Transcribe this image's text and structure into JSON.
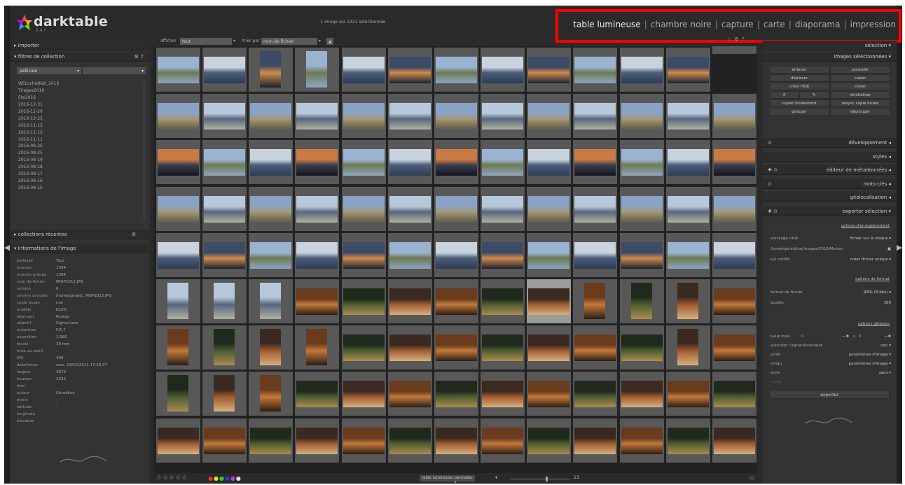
{
  "app": {
    "name": "darktable",
    "version": "2.4.?"
  },
  "header": {
    "selection_count": "1 image sur 1321 sélectionnée"
  },
  "views": [
    {
      "label": "table lumineuse",
      "active": true
    },
    {
      "label": "chambre noire",
      "active": false
    },
    {
      "label": "capture",
      "active": false
    },
    {
      "label": "carte",
      "active": false
    },
    {
      "label": "diaporama",
      "active": false
    },
    {
      "label": "impression",
      "active": false
    }
  ],
  "views_sep": "|",
  "toolbar": {
    "show_label": "afficher",
    "show_value": "tout",
    "sort_label": "trier par",
    "sort_value": "nom de fichier"
  },
  "left": {
    "import_label": "importer",
    "collect_label": "filtres de collection",
    "collect_icons": "⚙ ↑",
    "collect_property": "pellicule",
    "film_rolls": [
      "WELoche8&B_2016",
      "Tirages2016",
      "Ete2016",
      "2016-12-31",
      "2016-12-26",
      "2016-12-25",
      "2016-11-13",
      "2016-11-12",
      "2016-11-11",
      "2016-08-26",
      "2016-08-25",
      "2016-08-19",
      "2016-08-18",
      "2016-08-17",
      "2016-08-16",
      "2016-08-15"
    ],
    "recent_label": "collections récentes",
    "info_label": "informations de l'image",
    "info": [
      {
        "k": "pellicule",
        "v": "Tout"
      },
      {
        "k": "numéro",
        "v": "1564"
      },
      {
        "k": "numéro groupe",
        "v": "1564"
      },
      {
        "k": "nom de fichier",
        "v": "IMGP1812.JPG"
      },
      {
        "k": "version",
        "v": "0"
      },
      {
        "k": "chemin complet",
        "v": "/home/gerald...MGP1812.JPG"
      },
      {
        "k": "copie locale",
        "v": "non"
      },
      {
        "k": "modèle",
        "v": "K10D"
      },
      {
        "k": "fabricant",
        "v": "Pentax"
      },
      {
        "k": "objectif",
        "v": "Sigma Lens"
      },
      {
        "k": "ouverture",
        "v": "F/6.7"
      },
      {
        "k": "exposition",
        "v": "1/180"
      },
      {
        "k": "focale",
        "v": "18 mm"
      },
      {
        "k": "mise au point",
        "v": "-"
      },
      {
        "k": "ISO",
        "v": "400"
      },
      {
        "k": "date/heure",
        "v": "sam. 24/12/2011 17:26:07"
      },
      {
        "k": "largeur",
        "v": "3872"
      },
      {
        "k": "hauteur",
        "v": "2592"
      },
      {
        "k": "titre",
        "v": ""
      },
      {
        "k": "auteur",
        "v": "Géraldine"
      },
      {
        "k": "droits",
        "v": "-"
      },
      {
        "k": "latitude",
        "v": "-"
      },
      {
        "k": "longitude",
        "v": "-"
      },
      {
        "k": "élévation",
        "v": "-"
      }
    ]
  },
  "right": {
    "selection_label": "sélection",
    "selected_images_label": "images sélectionnées",
    "buttons": [
      [
        "enlever",
        "poubelle"
      ],
      [
        "déplacer",
        "copier"
      ],
      [
        "créer HDR",
        "cloner"
      ],
      [
        "↺",
        "↻",
        "réinitialiser"
      ],
      [
        "copier localement",
        "resync copie locale"
      ],
      [
        "grouper",
        "dégrouper"
      ]
    ],
    "modules": [
      "développement",
      "styles",
      "éditeur de métadonnées",
      "mots-clés",
      "géolocalisation",
      "exporter sélection"
    ],
    "storage_section": "options d'enregistrement",
    "storage_label": "stockage cible",
    "storage_value": "fichier sur le disque",
    "path_value": "/home/geraldine/images/2016/Maison",
    "conflict_label": "sur conflit",
    "conflict_value": "créer fichier unique",
    "format_section": "options de format",
    "format_label": "format de fichier",
    "format_value": "JPEG (8-bits)",
    "quality_label": "qualité",
    "quality_value": "100",
    "global_section": "options globales",
    "size_label": "taille max",
    "size_w": "0",
    "size_x": "x",
    "size_h": "0",
    "upscale_label": "autoriser l'agrandissement",
    "upscale_value": "non",
    "profile_label": "profil",
    "profile_value": "paramètres d'image",
    "intent_label": "rendu",
    "intent_value": "paramètres d'image",
    "style_label": "style",
    "style_value": "sans",
    "mode_label": "mode",
    "export_button": "exporter"
  },
  "bottom": {
    "stars": "☆☆☆☆☆",
    "layout_value": "table lumineuse zoomable",
    "zoom": "13"
  },
  "colors": {
    "accent_red": "#ff0000",
    "bg": "#2a2a2a",
    "thumb_bg": "#585858"
  }
}
